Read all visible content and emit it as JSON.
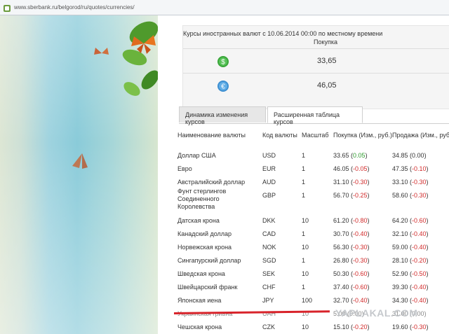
{
  "browser": {
    "url": "www.sberbank.ru/belgorod/ru/quotes/currencies/"
  },
  "rates_box": {
    "header": "Курсы иностранных валют с 10.06.2014 00:00 по местному времени",
    "column": "Покупка",
    "rows": [
      {
        "icon": "dollar-coin-icon",
        "value": "33,65"
      },
      {
        "icon": "euro-coin-icon",
        "value": "46,05"
      }
    ]
  },
  "tabs": [
    {
      "label": "Динамика изменения курсов",
      "active": false
    },
    {
      "label": "Расширенная таблица курсов",
      "active": true
    }
  ],
  "table": {
    "headers": [
      "Наименование валюты",
      "Код валюты",
      "Масштаб",
      "Покупка (Изм., руб.)",
      "Продажа (Изм., руб.)"
    ],
    "rows": [
      {
        "name": "Доллар США",
        "code": "USD",
        "scale": "1",
        "buy": "33.65",
        "buy_change": "0.05",
        "sell": "34.85",
        "sell_change": "0.00"
      },
      {
        "name": "Евро",
        "code": "EUR",
        "scale": "1",
        "buy": "46.05",
        "buy_change": "-0.05",
        "sell": "47.35",
        "sell_change": "-0.10"
      },
      {
        "name": "Австралийский доллар",
        "code": "AUD",
        "scale": "1",
        "buy": "31.10",
        "buy_change": "-0.30",
        "sell": "33.10",
        "sell_change": "-0.30"
      },
      {
        "name": "Фунт стерлингов Соединенного Королевства",
        "code": "GBP",
        "scale": "1",
        "buy": "56.70",
        "buy_change": "-0.25",
        "sell": "58.60",
        "sell_change": "-0.30"
      },
      {
        "name": "Датская крона",
        "code": "DKK",
        "scale": "10",
        "buy": "61.20",
        "buy_change": "-0.80",
        "sell": "64.20",
        "sell_change": "-0.60"
      },
      {
        "name": "Канадский доллар",
        "code": "CAD",
        "scale": "1",
        "buy": "30.70",
        "buy_change": "-0.40",
        "sell": "32.10",
        "sell_change": "-0.40"
      },
      {
        "name": "Норвежская крона",
        "code": "NOK",
        "scale": "10",
        "buy": "56.30",
        "buy_change": "-0.30",
        "sell": "59.00",
        "sell_change": "-0.40"
      },
      {
        "name": "Сингапурский доллар",
        "code": "SGD",
        "scale": "1",
        "buy": "26.80",
        "buy_change": "-0.30",
        "sell": "28.10",
        "sell_change": "-0.20"
      },
      {
        "name": "Шведская крона",
        "code": "SEK",
        "scale": "10",
        "buy": "50.30",
        "buy_change": "-0.60",
        "sell": "52.90",
        "sell_change": "-0.50"
      },
      {
        "name": "Швейцарский франк",
        "code": "CHF",
        "scale": "1",
        "buy": "37.40",
        "buy_change": "-0.60",
        "sell": "39.30",
        "sell_change": "-0.40"
      },
      {
        "name": "Японская иена",
        "code": "JPY",
        "scale": "100",
        "buy": "32.70",
        "buy_change": "-0.40",
        "sell": "34.30",
        "sell_change": "-0.40"
      },
      {
        "name": "Украинская гривна",
        "code": "UAH",
        "scale": "10",
        "buy": "5.00",
        "buy_change": "0.00",
        "sell": "31.00",
        "sell_change": "0.00"
      },
      {
        "name": "Чешская крона",
        "code": "CZK",
        "scale": "10",
        "buy": "15.10",
        "buy_change": "-0.20",
        "sell": "19.60",
        "sell_change": "-0.30"
      }
    ]
  },
  "watermark": "YAPLAKAL.COM",
  "colors": {
    "positive": "#2e9a2e",
    "negative": "#d12b2b",
    "highlight": "#d8232a",
    "coin_green": "#3aa63a",
    "coin_blue": "#3d8fd1"
  }
}
